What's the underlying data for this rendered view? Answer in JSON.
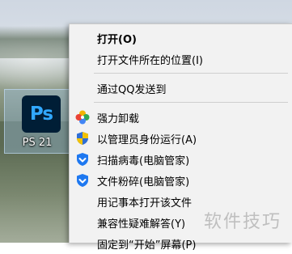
{
  "desktop": {
    "icon_tile_text": "Ps",
    "icon_label": "PS 21"
  },
  "context_menu": {
    "items": [
      {
        "label": "打开(O)",
        "bold": true,
        "icon": ""
      },
      {
        "label": "打开文件所在的位置(I)",
        "icon": ""
      },
      {
        "label": "通过QQ发送到",
        "icon": ""
      },
      {
        "label": "强力卸载",
        "icon": "pinwheel-icon"
      },
      {
        "label": "以管理员身份运行(A)",
        "icon": "uac-shield-icon"
      },
      {
        "label": "扫描病毒(电脑管家)",
        "icon": "tencent-shield-icon"
      },
      {
        "label": "文件粉碎(电脑管家)",
        "icon": "tencent-shield-icon"
      },
      {
        "label": "用记事本打开该文件",
        "icon": ""
      },
      {
        "label": "兼容性疑难解答(Y)",
        "icon": ""
      },
      {
        "label": "固定到“开始”屏幕(P)",
        "icon": ""
      }
    ]
  },
  "watermark": "软件技巧",
  "colors": {
    "menu_bg": "#f2f2f2",
    "ps_bg": "#001e36",
    "ps_text": "#31a8ff",
    "tencent_blue": "#1e78f0"
  }
}
